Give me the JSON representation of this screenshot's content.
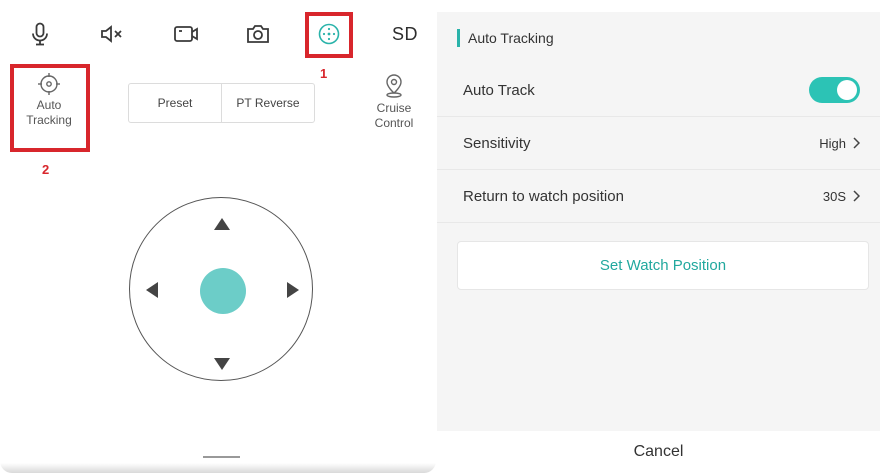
{
  "toolbar": {
    "microphone_icon": "microphone-icon",
    "mute_icon": "speaker-muted-icon",
    "record_icon": "video-camera-icon",
    "snapshot_icon": "camera-icon",
    "ptz_icon": "ptz-control-icon",
    "sd_label": "SD"
  },
  "annotations": {
    "step1": "1",
    "step2": "2",
    "highlight_color": "#d8262c"
  },
  "controls": {
    "auto_tracking_line1": "Auto",
    "auto_tracking_line2": "Tracking",
    "preset_label": "Preset",
    "pt_reverse_label": "PT Reverse",
    "cruise_line1": "Cruise",
    "cruise_line2": "Control"
  },
  "joystick": {
    "center_color": "#6ccdc8"
  },
  "settings": {
    "header_title": "Auto Tracking",
    "accent_color": "#2ab3aa",
    "auto_track_label": "Auto Track",
    "auto_track_on": true,
    "sensitivity_label": "Sensitivity",
    "sensitivity_value": "High",
    "return_label": "Return to watch position",
    "return_value": "30S",
    "set_watch_label": "Set Watch Position",
    "cancel_label": "Cancel"
  }
}
